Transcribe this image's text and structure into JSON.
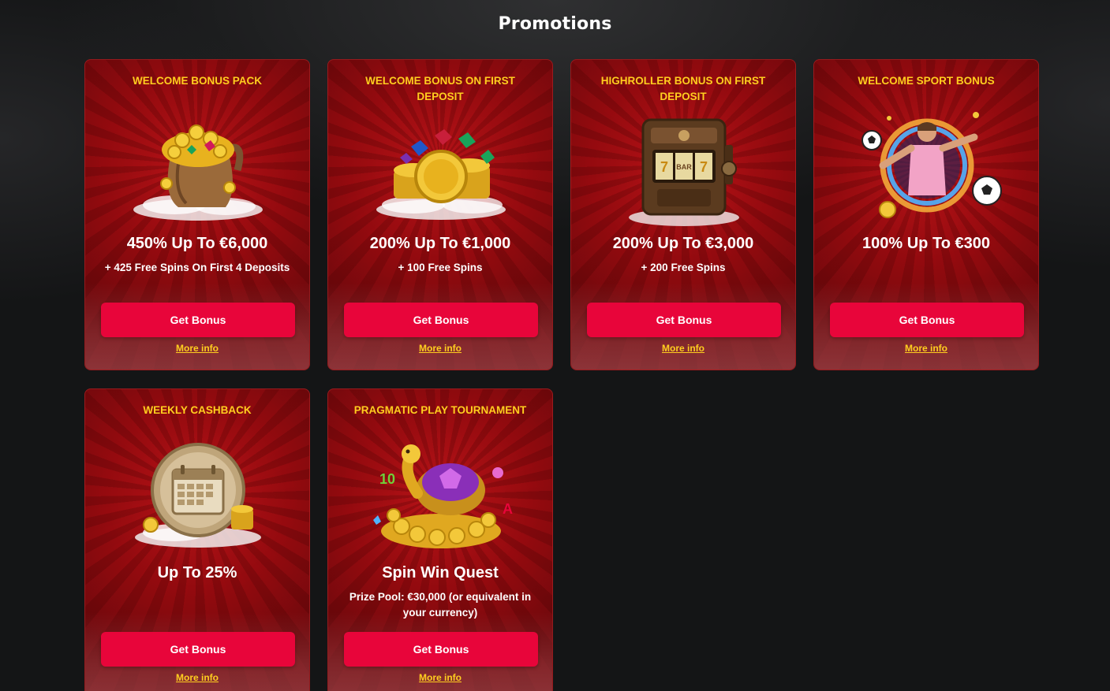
{
  "page": {
    "title": "Promotions"
  },
  "promotions": [
    {
      "label": "WELCOME BONUS PACK",
      "headline": "450% Up To €6,000",
      "sub": "+ 425 Free Spins On First 4 Deposits",
      "image": "gold-sack-icon",
      "button": "Get Bonus",
      "link": "More info"
    },
    {
      "label": "WELCOME BONUS ON FIRST DEPOSIT",
      "headline": "200% Up To €1,000",
      "sub": "+ 100 Free Spins",
      "image": "coin-stack-gems-icon",
      "button": "Get Bonus",
      "link": "More info"
    },
    {
      "label": "HIGHROLLER BONUS ON FIRST DEPOSIT",
      "headline": "200% Up To €3,000",
      "sub": "+ 200 Free Spins",
      "image": "slot-machine-icon",
      "button": "Get Bonus",
      "link": "More info"
    },
    {
      "label": "WELCOME SPORT BONUS",
      "headline": "100% Up To €300",
      "sub": "",
      "image": "footballer-portal-icon",
      "button": "Get Bonus",
      "link": "More info"
    },
    {
      "label": "WEEKLY CASHBACK",
      "headline": "Up To 25%",
      "sub": "",
      "image": "calendar-coins-icon",
      "button": "Get Bonus",
      "link": "More info"
    },
    {
      "label": "PRAGMATIC PLAY TOURNAMENT",
      "headline": "Spin Win Quest",
      "sub": "Prize Pool: €30,000 (or equivalent in your currency)",
      "image": "golden-turtle-icon",
      "button": "Get Bonus",
      "link": "More info"
    }
  ],
  "colors": {
    "accent": "#e8053a",
    "label": "#ffce1f",
    "card": "#9a0f14",
    "background": "#141516"
  }
}
